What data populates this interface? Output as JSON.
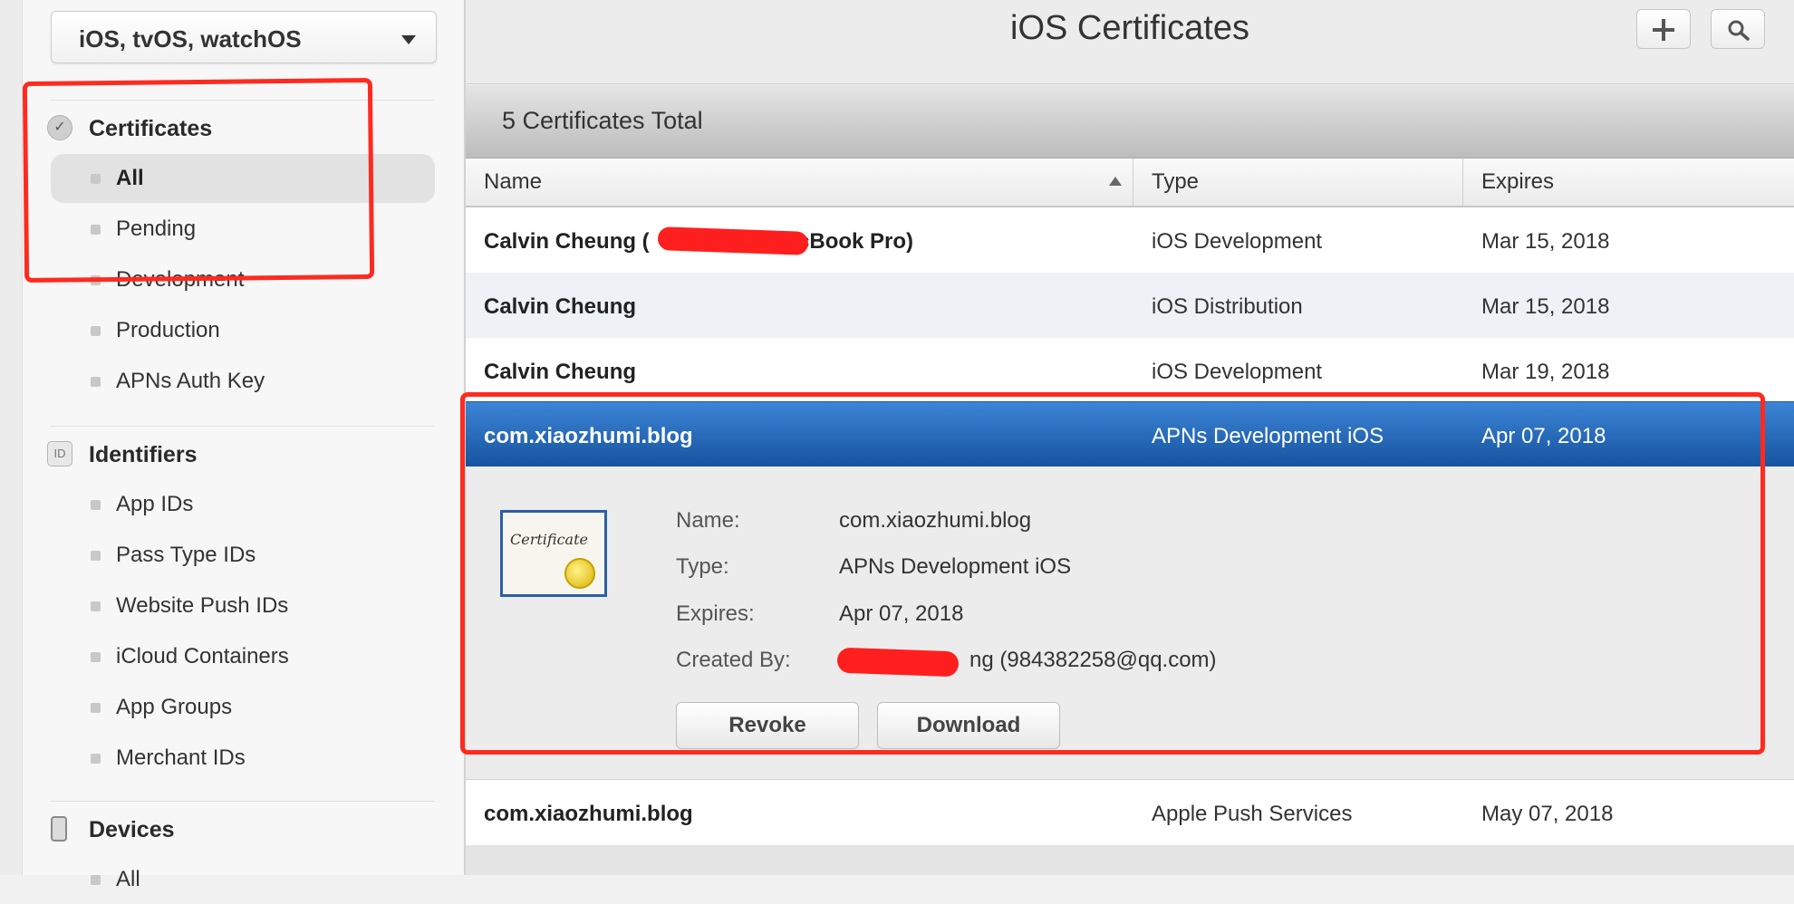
{
  "sidebar": {
    "platform": "iOS, tvOS, watchOS",
    "certificates": {
      "title": "Certificates",
      "items": [
        {
          "label": "All",
          "selected": true
        },
        {
          "label": "Pending"
        },
        {
          "label": "Development"
        },
        {
          "label": "Production"
        },
        {
          "label": "APNs Auth Key"
        }
      ]
    },
    "identifiers": {
      "title": "Identifiers",
      "icon_text": "ID",
      "items": [
        {
          "label": "App IDs"
        },
        {
          "label": "Pass Type IDs"
        },
        {
          "label": "Website Push IDs"
        },
        {
          "label": "iCloud Containers"
        },
        {
          "label": "App Groups"
        },
        {
          "label": "Merchant IDs"
        }
      ]
    },
    "devices": {
      "title": "Devices",
      "items": [
        {
          "label": "All"
        }
      ]
    }
  },
  "header": {
    "title": "iOS Certificates"
  },
  "table": {
    "total": "5 Certificates Total",
    "columns": {
      "name": "Name",
      "type": "Type",
      "expires": "Expires"
    },
    "rows": [
      {
        "name": "Calvin Cheung (",
        "name_tail": "acBook Pro)",
        "type": "iOS Development",
        "expires": "Mar 15, 2018"
      },
      {
        "name": "Calvin Cheung",
        "type": "iOS Distribution",
        "expires": "Mar 15, 2018"
      },
      {
        "name": "Calvin Cheung",
        "type": "iOS Development",
        "expires": "Mar 19, 2018"
      },
      {
        "name": "com.xiaozhumi.blog",
        "type": "APNs Development iOS",
        "expires": "Apr 07, 2018",
        "selected": true
      },
      {
        "name": "com.xiaozhumi.blog",
        "type": "Apple Push Services",
        "expires": "May 07, 2018"
      }
    ]
  },
  "detail": {
    "certificate_text": "Certificate",
    "labels": {
      "name": "Name:",
      "type": "Type:",
      "expires": "Expires:",
      "created_by": "Created By:"
    },
    "values": {
      "name": "com.xiaozhumi.blog",
      "type": "APNs Development iOS",
      "expires": "Apr 07, 2018",
      "created_by": "ng (984382258@qq.com)"
    },
    "buttons": {
      "revoke": "Revoke",
      "download": "Download"
    }
  },
  "colors": {
    "selection_top": "#3d84d6",
    "selection_bottom": "#15539f",
    "annotation": "#ff2a1f"
  },
  "icons": [
    "chevron-down-icon",
    "gear-check-icon",
    "id-icon",
    "device-icon",
    "plus-icon",
    "search-icon",
    "sort-ascending-icon",
    "certificate-icon"
  ]
}
